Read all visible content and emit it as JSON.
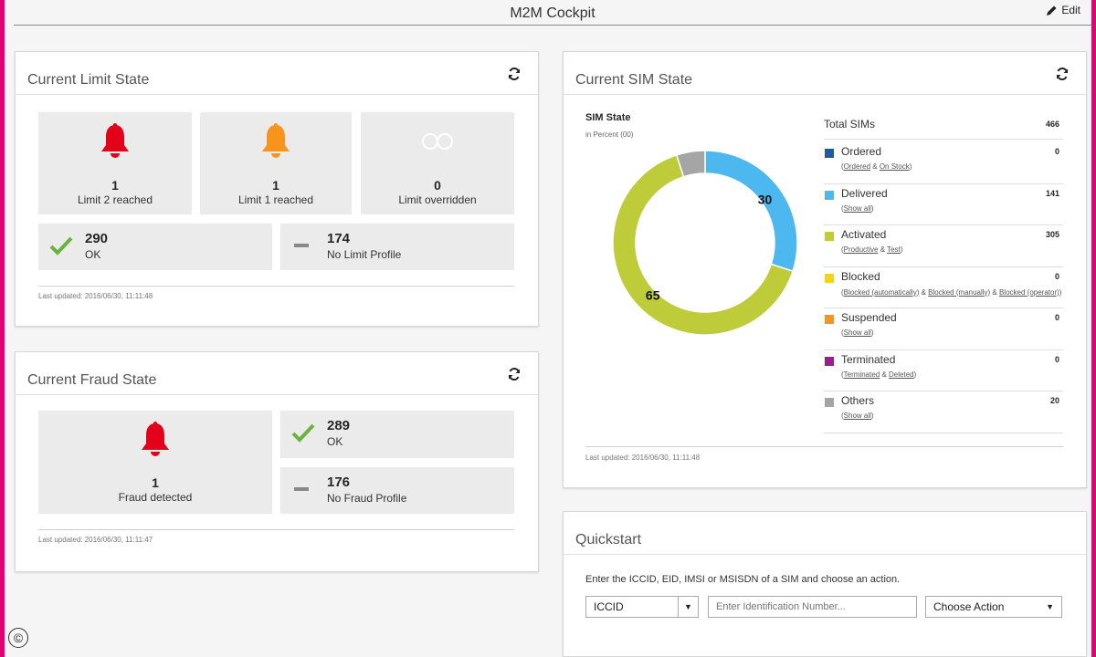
{
  "header": {
    "title": "M2M Cockpit",
    "edit_label": "Edit"
  },
  "limit_state": {
    "title": "Current Limit State",
    "tiles": [
      {
        "value": "1",
        "label": "Limit 2 reached"
      },
      {
        "value": "1",
        "label": "Limit 1 reached"
      },
      {
        "value": "0",
        "label": "Limit overridden"
      }
    ],
    "ok": {
      "value": "290",
      "label": "OK"
    },
    "no_profile": {
      "value": "174",
      "label": "No Limit Profile"
    },
    "updated": "Last updated: 2016/06/30, 11:11:48"
  },
  "fraud_state": {
    "title": "Current Fraud State",
    "detected": {
      "value": "1",
      "label": "Fraud detected"
    },
    "ok": {
      "value": "289",
      "label": "OK"
    },
    "no_profile": {
      "value": "176",
      "label": "No Fraud Profile"
    },
    "updated": "Last updated: 2016/06/30, 11:11:47"
  },
  "sim_state": {
    "title": "Current SIM State",
    "chart_title": "SIM State",
    "chart_subtitle": "in Percent (00)",
    "total_label": "Total SIMs",
    "total_value": "466",
    "legend": [
      {
        "name": "Ordered",
        "value": "0",
        "color": "#1a5aa6",
        "links": [
          "Ordered",
          "On Stock"
        ]
      },
      {
        "name": "Delivered",
        "value": "141",
        "color": "#4db7ef",
        "links": [
          "Show all"
        ]
      },
      {
        "name": "Activated",
        "value": "305",
        "color": "#bfcc3a",
        "links": [
          "Productive",
          "Test"
        ]
      },
      {
        "name": "Blocked",
        "value": "0",
        "color": "#f5d31b",
        "links": [
          "Blocked (automatically)",
          "Blocked (manually)",
          "Blocked (operator)"
        ]
      },
      {
        "name": "Suspended",
        "value": "0",
        "color": "#f7941d",
        "links": [
          "Show all"
        ]
      },
      {
        "name": "Terminated",
        "value": "0",
        "color": "#9b1e91",
        "links": [
          "Terminated",
          "Deleted"
        ]
      },
      {
        "name": "Others",
        "value": "20",
        "color": "#a5a5a5",
        "links": [
          "Show all"
        ]
      }
    ],
    "updated": "Last updated: 2016/06/30, 11:11:48"
  },
  "chart_data": {
    "type": "pie",
    "title": "SIM State",
    "subtitle": "in Percent (00)",
    "categories": [
      "Delivered",
      "Activated",
      "Others"
    ],
    "values": [
      30,
      65,
      5
    ],
    "data_labels": [
      "30",
      "65",
      ""
    ],
    "colors": [
      "#4db7ef",
      "#bfcc3a",
      "#a5a5a5"
    ]
  },
  "quickstart": {
    "title": "Quickstart",
    "instruction": "Enter the ICCID, EID, IMSI or MSISDN of a SIM and choose an action.",
    "id_type": "ICCID",
    "id_placeholder": "Enter Identification Number...",
    "action_label": "Choose Action"
  },
  "colors": {
    "accent": "#e20074",
    "alert_red": "#e2001a",
    "alert_orange": "#f7941d",
    "ok_green": "#6cb33e"
  }
}
